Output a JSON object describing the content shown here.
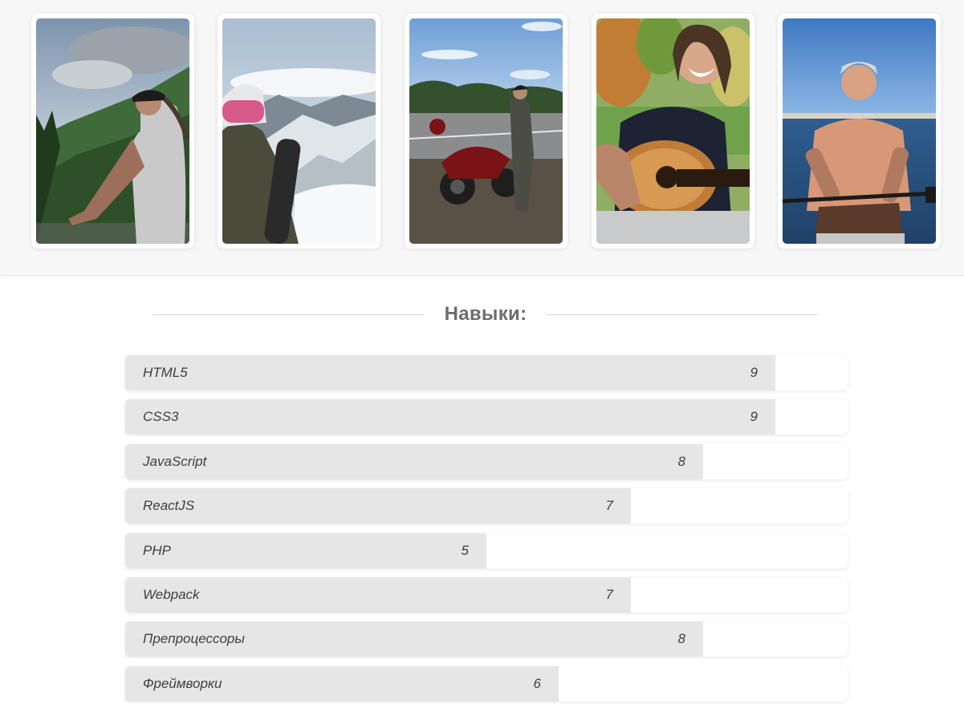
{
  "gallery": {
    "photos": [
      {
        "alt": "man-on-mountain-balcony"
      },
      {
        "alt": "snowboarder-in-mountains"
      },
      {
        "alt": "man-with-motorcycle"
      },
      {
        "alt": "man-with-guitar"
      },
      {
        "alt": "man-on-paddleboard"
      }
    ]
  },
  "skills": {
    "title": "Навыки:",
    "max": 10,
    "items": [
      {
        "name": "HTML5",
        "value": 9,
        "label": "9"
      },
      {
        "name": "CSS3",
        "value": 9,
        "label": "9"
      },
      {
        "name": "JavaScript",
        "value": 8,
        "label": "8"
      },
      {
        "name": "ReactJS",
        "value": 7,
        "label": "7"
      },
      {
        "name": "PHP",
        "value": 5,
        "label": "5"
      },
      {
        "name": "Webpack",
        "value": 7,
        "label": "7"
      },
      {
        "name": "Препроцессоры",
        "value": 8,
        "label": "8"
      },
      {
        "name": "Фреймворки",
        "value": 6,
        "label": "6"
      }
    ]
  },
  "colors": {
    "bar_fill": "#e6e6e6",
    "text": "#3f3f3f",
    "heading": "#6d6d6d"
  }
}
